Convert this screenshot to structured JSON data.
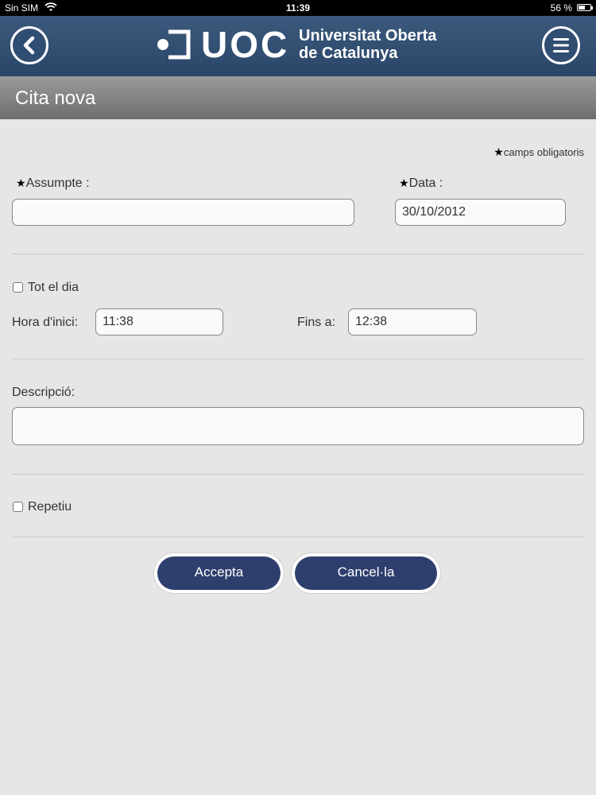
{
  "status_bar": {
    "carrier": "Sin SIM",
    "time": "11:39",
    "battery": "56 %",
    "battery_level": 0.56
  },
  "header": {
    "back_icon": "chevron-left-icon",
    "menu_icon": "hamburger-menu-icon",
    "logo_text": "UOC",
    "logo_line1": "Universitat Oberta",
    "logo_line2": "de Catalunya"
  },
  "page_title": "Cita nova",
  "form": {
    "required_note": "camps obligatoris",
    "required_star": "★",
    "subject_label": "Assumpte :",
    "subject_value": "",
    "date_label": "Data :",
    "date_value": "30/10/2012",
    "all_day_label": "Tot el dia",
    "start_label": "Hora d'inici:",
    "start_value": "11:38",
    "end_label": "Fins a:",
    "end_value": "12:38",
    "description_label": "Descripció:",
    "description_value": "",
    "repeat_label": "Repetiu"
  },
  "buttons": {
    "accept": "Accepta",
    "cancel": "Cancel·la"
  },
  "colors": {
    "header": "#2f4d72",
    "button": "#2e3f6e",
    "titlebar": "#808080",
    "background": "#e6e6e7"
  }
}
